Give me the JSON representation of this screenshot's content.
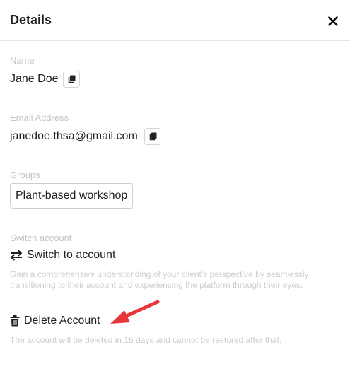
{
  "header": {
    "title": "Details",
    "close_icon": "close-x-icon"
  },
  "name": {
    "label": "Name",
    "value": "Jane Doe",
    "copy_icon": "copy-icon"
  },
  "email": {
    "label": "Email Address",
    "value": "janedoe.thsa@gmail.com",
    "copy_icon": "copy-icon"
  },
  "groups": {
    "label": "Groups",
    "items": [
      "Plant-based workshop"
    ]
  },
  "switch_account": {
    "label": "Switch account",
    "action_label": "Switch to account",
    "icon": "swap-arrows-icon",
    "description": "Gain a comprehensive understanding of your client's perspective by seamlessly transitioning to their account and experiencing the platform through their eyes."
  },
  "delete_account": {
    "action_label": "Delete Account",
    "icon": "trash-icon",
    "description": "The account will be deleted in 15 days and cannot be restored after that."
  },
  "annotation": {
    "icon": "red-arrow-annotation",
    "color": "#e8363a"
  }
}
